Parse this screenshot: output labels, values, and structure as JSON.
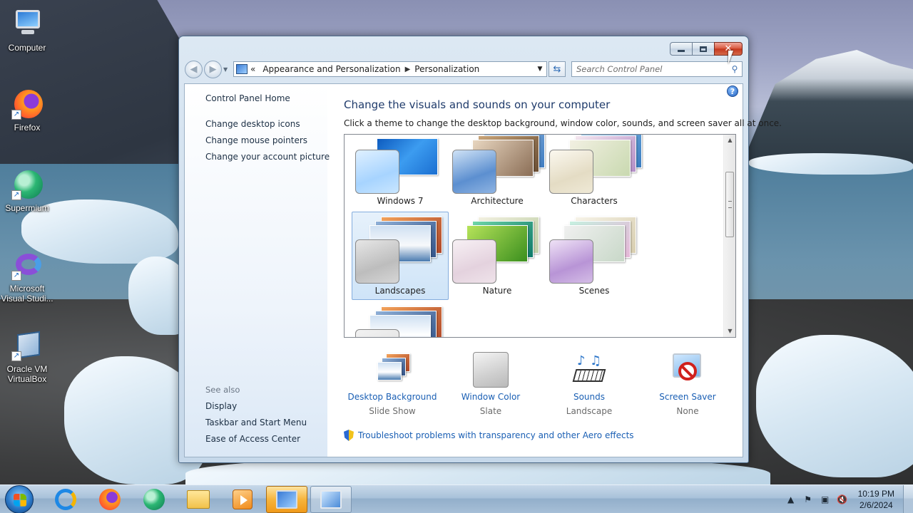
{
  "desktop": {
    "icons": [
      {
        "label": "Computer"
      },
      {
        "label": "Firefox"
      },
      {
        "label": "Supermium"
      },
      {
        "label": "Microsoft Visual Studi..."
      },
      {
        "label": "Oracle VM VirtualBox"
      }
    ]
  },
  "window": {
    "breadcrumb": {
      "overflow": "«",
      "items": [
        "Appearance and Personalization",
        "Personalization"
      ]
    },
    "search": {
      "placeholder": "Search Control Panel"
    },
    "left_pane": {
      "links": [
        "Control Panel Home",
        "Change desktop icons",
        "Change mouse pointers",
        "Change your account picture"
      ],
      "see_also_heading": "See also",
      "see_also_links": [
        "Display",
        "Taskbar and Start Menu",
        "Ease of Access Center"
      ]
    },
    "main": {
      "title": "Change the visuals and sounds on your computer",
      "subtitle": "Click a theme to change the desktop background, window color, sounds, and screen saver all at once.",
      "themes": [
        {
          "name": "Windows 7",
          "selected": false
        },
        {
          "name": "Architecture",
          "selected": false
        },
        {
          "name": "Characters",
          "selected": false
        },
        {
          "name": "Landscapes",
          "selected": true
        },
        {
          "name": "Nature",
          "selected": false
        },
        {
          "name": "Scenes",
          "selected": false
        }
      ],
      "settings": [
        {
          "label": "Desktop Background",
          "value": "Slide Show"
        },
        {
          "label": "Window Color",
          "value": "Slate"
        },
        {
          "label": "Sounds",
          "value": "Landscape"
        },
        {
          "label": "Screen Saver",
          "value": "None"
        }
      ],
      "troubleshoot_link": "Troubleshoot problems with transparency and other Aero effects"
    }
  },
  "taskbar": {
    "clock": {
      "time": "10:19 PM",
      "date": "2/6/2024"
    }
  },
  "colors": {
    "link": "#1a5fb4",
    "title": "#1f3b6b",
    "selected_theme_border": "#84acdd",
    "close_button": "#c3361c",
    "taskbar_active": "#f6b43c"
  }
}
